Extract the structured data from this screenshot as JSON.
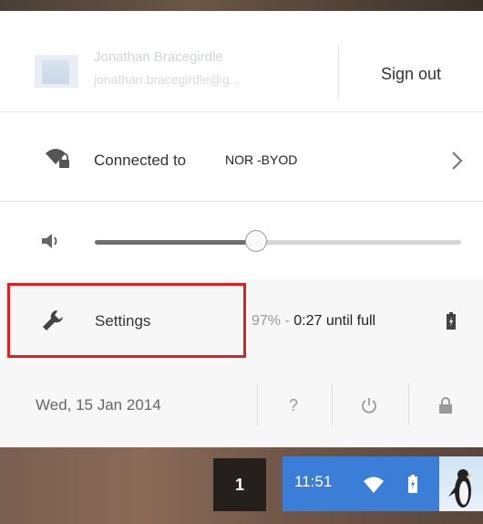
{
  "user": {
    "name": "Jonathan Bracegirdle",
    "email": "jonathan.bracegirdle@g...",
    "sign_out_label": "Sign out"
  },
  "network": {
    "label": "Connected to",
    "ssid": "NOR -BYOD",
    "icon": "wifi-lock-icon"
  },
  "volume": {
    "icon": "speaker-icon",
    "level_fraction": 0.44
  },
  "settings": {
    "label": "Settings",
    "icon": "wrench-icon",
    "highlight_color": "#e02020"
  },
  "battery": {
    "percent_text": "97% - ",
    "time_text": "0:27 until full",
    "icon": "battery-charging-icon"
  },
  "footer": {
    "date": "Wed, 15 Jan 2014",
    "help_label": "?",
    "power_icon": "power-icon",
    "lock_icon": "lock-icon"
  },
  "shelf": {
    "workspace": "1",
    "clock": "11:51",
    "status_area_color": "#3a7ed8"
  }
}
